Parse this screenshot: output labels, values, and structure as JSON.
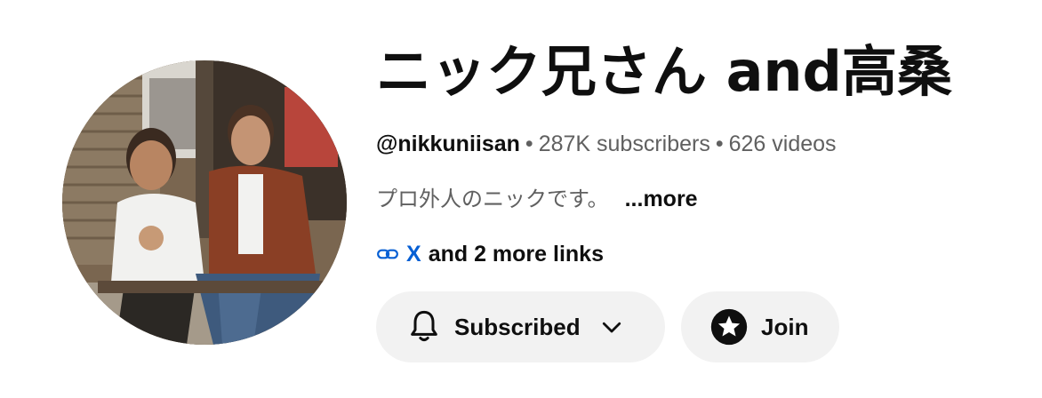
{
  "channel": {
    "title": "ニック兄さん and高桑",
    "handle": "@nikkuniisan",
    "separator": "•",
    "subscribers": "287K subscribers",
    "videos": "626 videos",
    "description": "プロ外人のニックです。",
    "more_label": "...more"
  },
  "links": {
    "icon": "link-icon",
    "primary": "X",
    "more": "and 2 more links"
  },
  "actions": {
    "subscribed_label": "Subscribed",
    "join_label": "Join"
  },
  "colors": {
    "link_blue": "#065fd4",
    "button_bg": "#f2f2f2",
    "text_primary": "#0f0f0f",
    "text_secondary": "#606060"
  }
}
